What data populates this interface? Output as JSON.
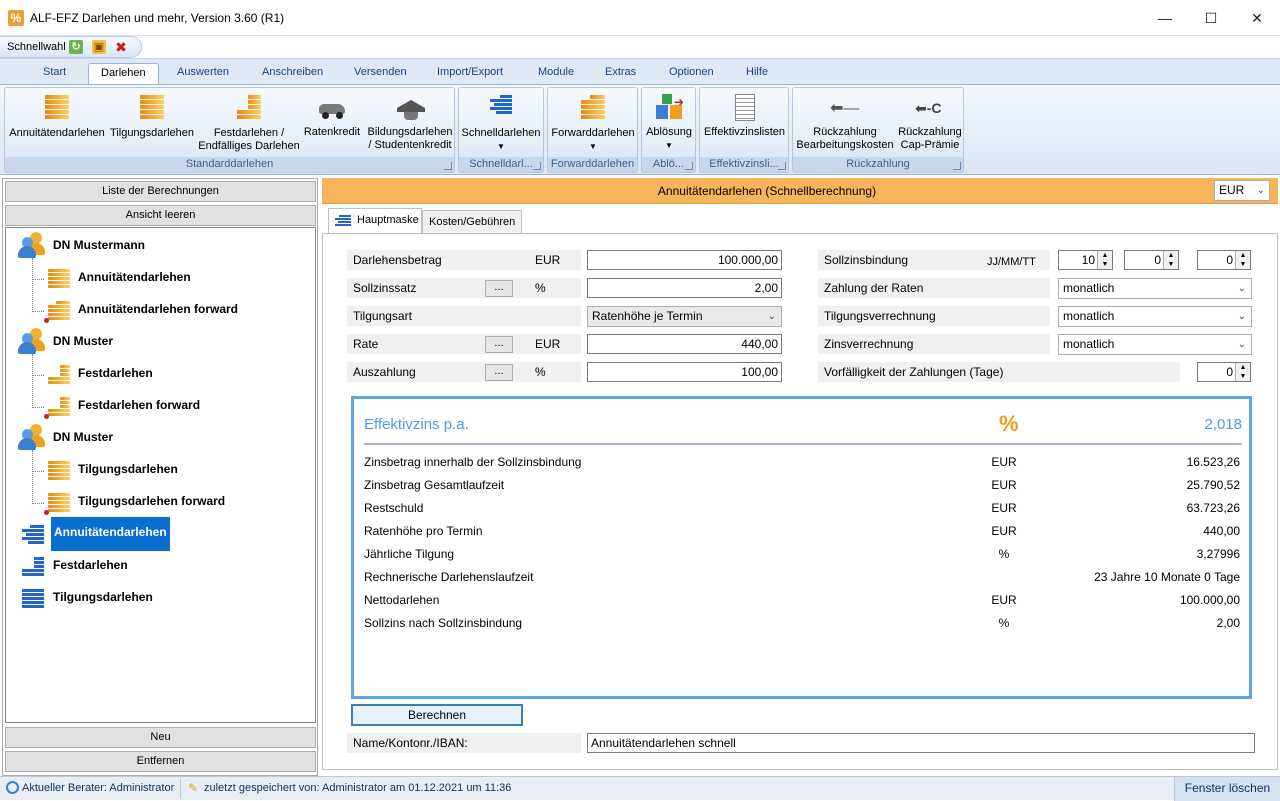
{
  "window": {
    "title": "ALF-EFZ Darlehen und mehr, Version 3.60 (R1)"
  },
  "quick_access": {
    "label": "Schnellwahl"
  },
  "ribbon_tabs": [
    "Start",
    "Darlehen",
    "Auswerten",
    "Anschreiben",
    "Versenden",
    "Import/Export",
    "Module",
    "Extras",
    "Optionen",
    "Hilfe"
  ],
  "ribbon": {
    "annuitaet": "Annuitätendarlehen",
    "tilgung": "Tilgungsdarlehen",
    "fest_l1": "Festdarlehen /",
    "fest_l2": "Endfälliges Darlehen",
    "raten": "Ratenkredit",
    "bildung_l1": "Bildungsdarlehen",
    "bildung_l2": "/ Studentenkredit",
    "grp_standard": "Standarddarlehen",
    "schnell": "Schnelldarlehen",
    "grp_schnell": "Schnelldarl...",
    "forward": "Forwarddarlehen",
    "grp_forward": "Forwarddarlehen",
    "abloesung": "Ablösung",
    "grp_abloesung": "Ablö...",
    "effektiv": "Effektivzinslisten",
    "grp_effektiv": "Effektivzinsli...",
    "rueck1_l1": "Rückzahlung",
    "rueck1_l2": "Bearbeitungskosten",
    "rueck2_l1": "Rückzahlung",
    "rueck2_l2": "Cap-Prämie",
    "grp_rueck": "Rückzahlung"
  },
  "left": {
    "list_btn": "Liste der Berechnungen",
    "clear_btn": "Ansicht leeren",
    "new_btn": "Neu",
    "remove_btn": "Entfernen"
  },
  "tree": [
    {
      "label": "DN Mustermann"
    },
    {
      "label": "Annuitätendarlehen"
    },
    {
      "label": "Annuitätendarlehen forward"
    },
    {
      "label": "DN Muster"
    },
    {
      "label": "Festdarlehen"
    },
    {
      "label": "Festdarlehen forward"
    },
    {
      "label": "DN Muster"
    },
    {
      "label": "Tilgungsdarlehen"
    },
    {
      "label": "Tilgungsdarlehen forward"
    },
    {
      "label": "Annuitätendarlehen"
    },
    {
      "label": "Festdarlehen"
    },
    {
      "label": "Tilgungsdarlehen"
    }
  ],
  "main": {
    "header": "Annuitätendarlehen (Schnellberechnung)",
    "currency": "EUR",
    "tab_main": "Hauptmaske",
    "tab_costs": "Kosten/Gebühren"
  },
  "form": {
    "darlehensbetrag_label": "Darlehensbetrag",
    "darlehensbetrag_unit": "EUR",
    "darlehensbetrag": "100.000,00",
    "sollzins_label": "Sollzinssatz",
    "sollzins_unit": "%",
    "sollzins": "2,00",
    "tilgungsart_label": "Tilgungsart",
    "tilgungsart": "Ratenhöhe je Termin",
    "rate_label": "Rate",
    "rate_unit": "EUR",
    "rate": "440,00",
    "auszahlung_label": "Auszahlung",
    "auszahlung_unit": "%",
    "auszahlung": "100,00",
    "dots": "...",
    "bindung_label": "Sollzinsbindung",
    "bindung_unit": "JJ/MM/TT",
    "bindung_jj": "10",
    "bindung_mm": "0",
    "bindung_tt": "0",
    "zahlung_label": "Zahlung der Raten",
    "zahlung": "monatlich",
    "tilgverr_label": "Tilgungsverrechnung",
    "tilgverr": "monatlich",
    "zinsverr_label": "Zinsverrechnung",
    "zinsverr": "monatlich",
    "faellig_label": "Vorfälligkeit der Zahlungen (Tage)",
    "faellig": "0"
  },
  "result": {
    "eff_label": "Effektivzins p.a.",
    "eff_symbol": "%",
    "eff_value": "2,018",
    "rows": [
      {
        "label": "Zinsbetrag innerhalb der Sollzinsbindung",
        "unit": "EUR",
        "value": "16.523,26"
      },
      {
        "label": "Zinsbetrag Gesamtlaufzeit",
        "unit": "EUR",
        "value": "25.790,52"
      },
      {
        "label": "Restschuld",
        "unit": "EUR",
        "value": "63.723,26"
      },
      {
        "label": "Ratenhöhe pro Termin",
        "unit": "EUR",
        "value": "440,00"
      },
      {
        "label": "Jährliche Tilgung",
        "unit": "%",
        "value": "3,27996"
      },
      {
        "label": "Rechnerische Darlehenslaufzeit",
        "unit": "",
        "value": "23 Jahre 10 Monate 0 Tage"
      },
      {
        "label": "Nettodarlehen",
        "unit": "EUR",
        "value": "100.000,00"
      },
      {
        "label": "Sollzins nach Sollzinsbindung",
        "unit": "%",
        "value": "2,00"
      }
    ]
  },
  "calc_btn": "Berechnen",
  "name_label": "Name/Kontonr./IBAN:",
  "name_value": "Annuitätendarlehen schnell",
  "status": {
    "berater": "Aktueller Berater: Administrator",
    "saved": "zuletzt gespeichert von: Administrator am 01.12.2021 um 11:36",
    "fenster": "Fenster löschen"
  }
}
